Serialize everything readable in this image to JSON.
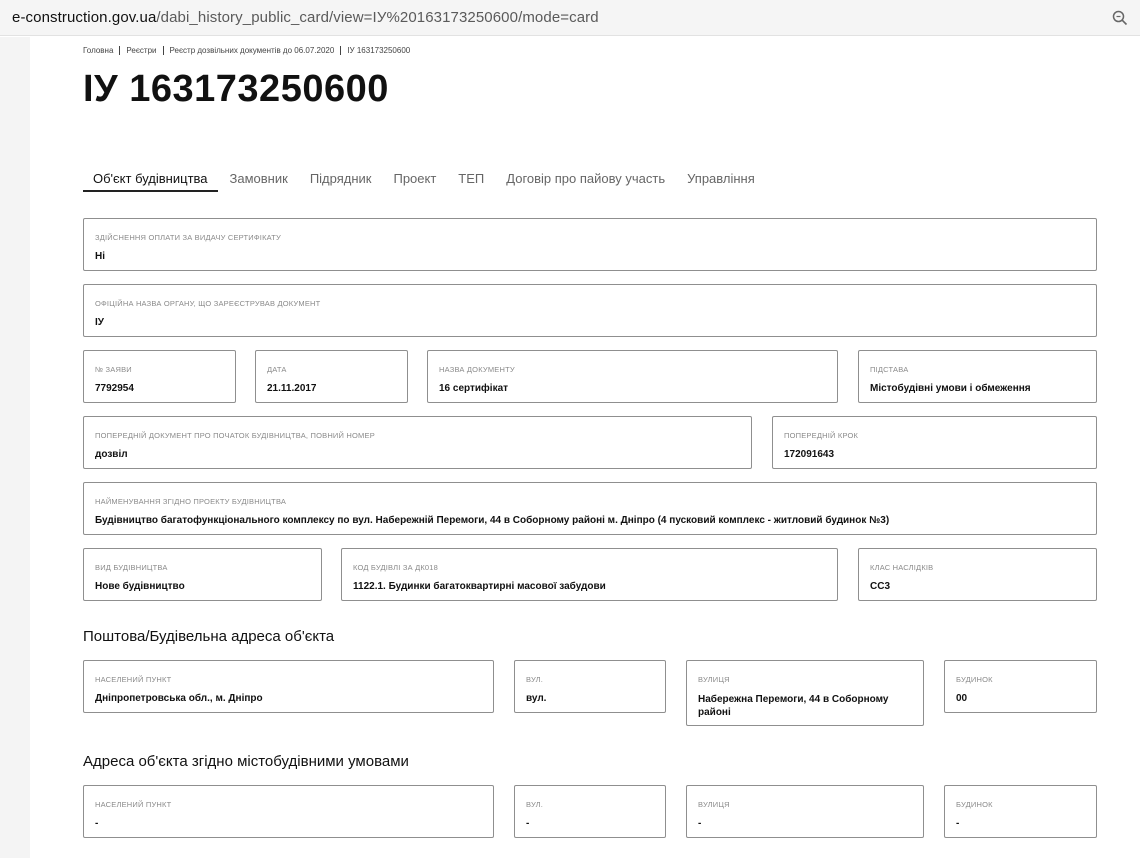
{
  "browser": {
    "url_host": "e-construction.gov.ua",
    "url_path": "/dabi_history_public_card/view=ІУ%20163173250600/mode=card"
  },
  "breadcrumb": [
    "Головна",
    "Реєстри",
    "Реєстр дозвільних документів до 06.07.2020",
    "ІУ 163173250600"
  ],
  "page_title": "ІУ 163173250600",
  "tabs": [
    "Об'єкт будівництва",
    "Замовник",
    "Підрядник",
    "Проект",
    "ТЕП",
    "Договір про пайову участь",
    "Управління"
  ],
  "fields": {
    "payment": {
      "label": "Здійснення оплати за видачу сертифікату",
      "value": "Ні"
    },
    "authority": {
      "label": "Офіційна назва органу, що зареєстрував документ",
      "value": "ІУ"
    },
    "application_no": {
      "label": "№ заяви",
      "value": "7792954"
    },
    "date": {
      "label": "Дата",
      "value": "21.11.2017"
    },
    "doc_name": {
      "label": "Назва документу",
      "value": "16 сертифікат"
    },
    "basis": {
      "label": "Підстава",
      "value": "Містобудівні умови і обмеження"
    },
    "prev_doc": {
      "label": "Попередній документ про початок будівництва, повний номер",
      "value": "дозвіл"
    },
    "prev_step": {
      "label": "Попередній крок",
      "value": "172091643"
    },
    "project_name": {
      "label": "Найменування згідно проекту будівництва",
      "value": "Будівництво багатофункціонального комплексу по вул. Набережній Перемоги, 44 в Соборному районі м. Дніпро (4 пусковий комплекс - житловий будинок №3)"
    },
    "construction_type": {
      "label": "Вид будівництва",
      "value": "Нове будівництво"
    },
    "building_code": {
      "label": "Код будівлі за ДК018",
      "value": "1122.1. Будинки багатоквартирні масової забудови"
    },
    "consequence_class": {
      "label": "Клас наслідків",
      "value": "СС3"
    }
  },
  "postal_address": {
    "title": "Поштова/Будівельна адреса об'єкта",
    "settlement": {
      "label": "Населений пункт",
      "value": "Дніпропетровська обл., м. Дніпро"
    },
    "street_type": {
      "label": "Вул.",
      "value": "вул."
    },
    "street": {
      "label": "Вулиця",
      "value": "Набережна Перемоги, 44 в Соборному районі"
    },
    "building": {
      "label": "Будинок",
      "value": "00"
    }
  },
  "urban_address": {
    "title": "Адреса об'єкта згідно містобудівними умовами",
    "settlement": {
      "label": "Населений пункт",
      "value": "-"
    },
    "street_type": {
      "label": "Вул.",
      "value": "-"
    },
    "street": {
      "label": "Вулиця",
      "value": "-"
    },
    "building": {
      "label": "Будинок",
      "value": "-"
    }
  }
}
